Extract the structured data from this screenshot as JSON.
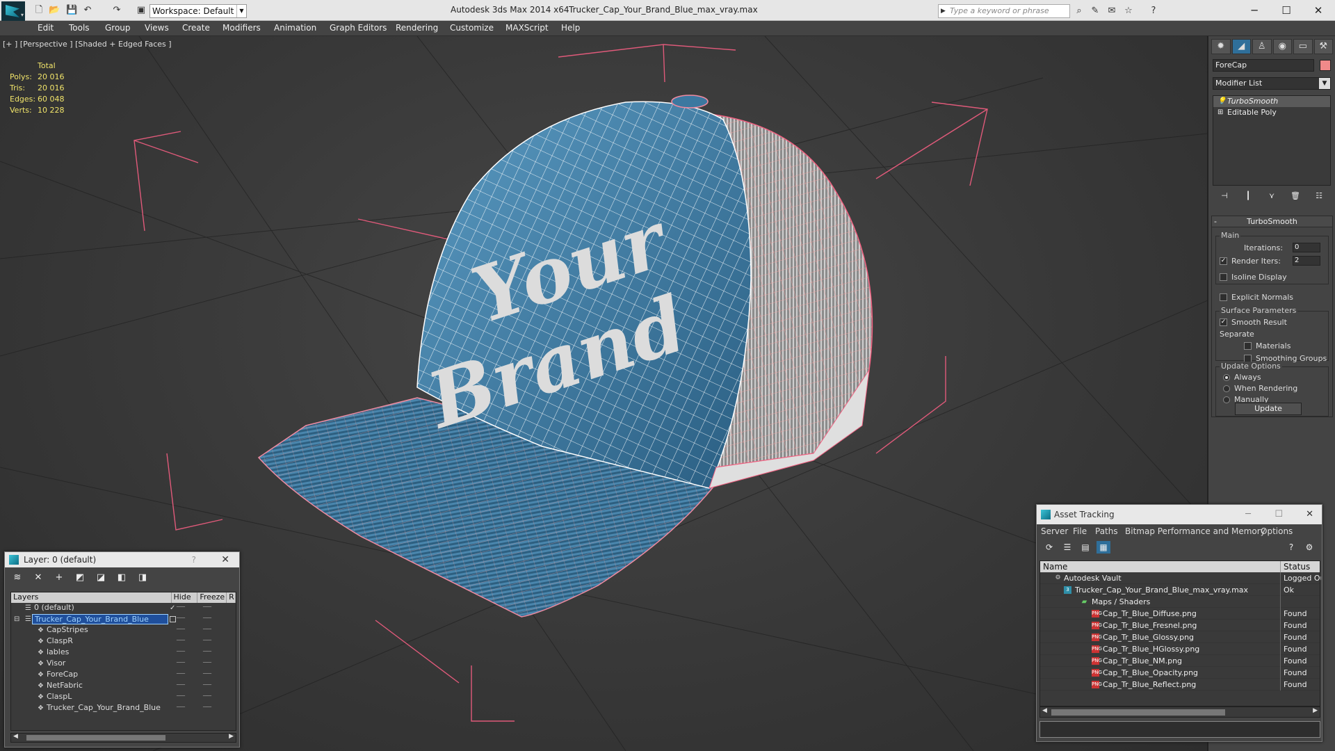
{
  "titlebar": {
    "workspace": "Workspace: Default",
    "app_title": "Autodesk 3ds Max  2014 x64",
    "file_title": "Trucker_Cap_Your_Brand_Blue_max_vray.max",
    "search_placeholder": "Type a keyword or phrase"
  },
  "menu": [
    "Edit",
    "Tools",
    "Group",
    "Views",
    "Create",
    "Modifiers",
    "Animation",
    "Graph Editors",
    "Rendering",
    "Customize",
    "MAXScript",
    "Help"
  ],
  "viewport": {
    "label": "[+ ] [Perspective ] [Shaded + Edged Faces ]",
    "stats": {
      "header": "Total",
      "rows": [
        {
          "k": "Polys:",
          "v": "20 016"
        },
        {
          "k": "Tris:",
          "v": "20 016"
        },
        {
          "k": "Edges:",
          "v": "60 048"
        },
        {
          "k": "Verts:",
          "v": "10 228"
        }
      ]
    },
    "logo_text_1": "Your",
    "logo_text_2": "Brand"
  },
  "command_panel": {
    "object_name": "ForeCap",
    "object_color": "#f08a8a",
    "modifier_list": "Modifier List",
    "stack": [
      "TurboSmooth",
      "Editable Poly"
    ],
    "turbosmooth": {
      "title": "TurboSmooth",
      "main_label": "Main",
      "iterations_label": "Iterations:",
      "iterations": "0",
      "render_iters_label": "Render Iters:",
      "render_iters": "2",
      "isoline": "Isoline Display",
      "explicit": "Explicit Normals",
      "surface_label": "Surface Parameters",
      "smooth_result": "Smooth Result",
      "separate": "Separate",
      "materials": "Materials",
      "smoothing_groups": "Smoothing Groups",
      "update_label": "Update Options",
      "always": "Always",
      "when_rendering": "When Rendering",
      "manually": "Manually",
      "update_button": "Update"
    }
  },
  "layer_dialog": {
    "title": "Layer: 0 (default)",
    "help": "?",
    "columns": [
      "Layers",
      "Hide",
      "Freeze",
      "R"
    ],
    "rows": [
      {
        "name": "0 (default)",
        "indent": 0
      },
      {
        "name": "Trucker_Cap_Your_Brand_Blue",
        "indent": 0
      },
      {
        "name": "CapStripes",
        "indent": 1
      },
      {
        "name": "ClaspR",
        "indent": 1
      },
      {
        "name": "lables",
        "indent": 1
      },
      {
        "name": "Visor",
        "indent": 1
      },
      {
        "name": "ForeCap",
        "indent": 1
      },
      {
        "name": "NetFabric",
        "indent": 1
      },
      {
        "name": "ClaspL",
        "indent": 1
      },
      {
        "name": "Trucker_Cap_Your_Brand_Blue",
        "indent": 1
      }
    ]
  },
  "asset_dialog": {
    "title": "Asset Tracking",
    "menu": [
      "Server",
      "File",
      "Paths",
      "Bitmap Performance and Memory",
      "Options"
    ],
    "columns": [
      "Name",
      "Status"
    ],
    "rows": [
      {
        "name": "Autodesk Vault",
        "status": "Logged Ou",
        "level": 0
      },
      {
        "name": "Trucker_Cap_Your_Brand_Blue_max_vray.max",
        "status": "Ok",
        "level": 1
      },
      {
        "name": "Maps / Shaders",
        "status": "",
        "level": 2
      },
      {
        "name": "Cap_Tr_Blue_Diffuse.png",
        "status": "Found",
        "level": 3
      },
      {
        "name": "Cap_Tr_Blue_Fresnel.png",
        "status": "Found",
        "level": 3
      },
      {
        "name": "Cap_Tr_Blue_Glossy.png",
        "status": "Found",
        "level": 3
      },
      {
        "name": "Cap_Tr_Blue_HGlossy.png",
        "status": "Found",
        "level": 3
      },
      {
        "name": "Cap_Tr_Blue_NM.png",
        "status": "Found",
        "level": 3
      },
      {
        "name": "Cap_Tr_Blue_Opacity.png",
        "status": "Found",
        "level": 3
      },
      {
        "name": "Cap_Tr_Blue_Reflect.png",
        "status": "Found",
        "level": 3
      }
    ]
  }
}
